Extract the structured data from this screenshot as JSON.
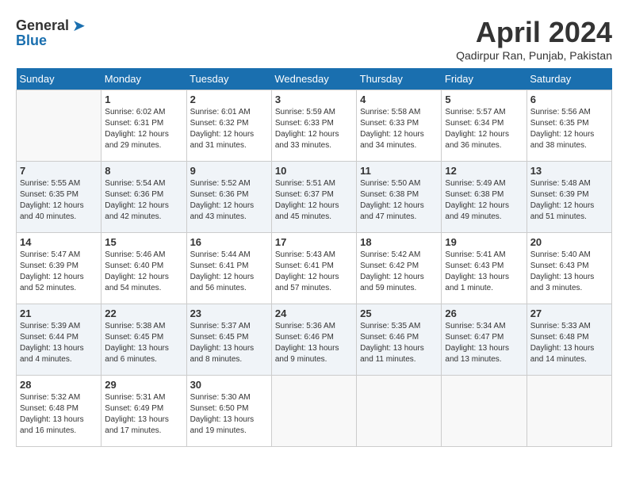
{
  "header": {
    "logo_general": "General",
    "logo_blue": "Blue",
    "month_title": "April 2024",
    "location": "Qadirpur Ran, Punjab, Pakistan"
  },
  "columns": [
    "Sunday",
    "Monday",
    "Tuesday",
    "Wednesday",
    "Thursday",
    "Friday",
    "Saturday"
  ],
  "weeks": [
    [
      {
        "day": "",
        "sunrise": "",
        "sunset": "",
        "daylight": ""
      },
      {
        "day": "1",
        "sunrise": "Sunrise: 6:02 AM",
        "sunset": "Sunset: 6:31 PM",
        "daylight": "Daylight: 12 hours and 29 minutes."
      },
      {
        "day": "2",
        "sunrise": "Sunrise: 6:01 AM",
        "sunset": "Sunset: 6:32 PM",
        "daylight": "Daylight: 12 hours and 31 minutes."
      },
      {
        "day": "3",
        "sunrise": "Sunrise: 5:59 AM",
        "sunset": "Sunset: 6:33 PM",
        "daylight": "Daylight: 12 hours and 33 minutes."
      },
      {
        "day": "4",
        "sunrise": "Sunrise: 5:58 AM",
        "sunset": "Sunset: 6:33 PM",
        "daylight": "Daylight: 12 hours and 34 minutes."
      },
      {
        "day": "5",
        "sunrise": "Sunrise: 5:57 AM",
        "sunset": "Sunset: 6:34 PM",
        "daylight": "Daylight: 12 hours and 36 minutes."
      },
      {
        "day": "6",
        "sunrise": "Sunrise: 5:56 AM",
        "sunset": "Sunset: 6:35 PM",
        "daylight": "Daylight: 12 hours and 38 minutes."
      }
    ],
    [
      {
        "day": "7",
        "sunrise": "Sunrise: 5:55 AM",
        "sunset": "Sunset: 6:35 PM",
        "daylight": "Daylight: 12 hours and 40 minutes."
      },
      {
        "day": "8",
        "sunrise": "Sunrise: 5:54 AM",
        "sunset": "Sunset: 6:36 PM",
        "daylight": "Daylight: 12 hours and 42 minutes."
      },
      {
        "day": "9",
        "sunrise": "Sunrise: 5:52 AM",
        "sunset": "Sunset: 6:36 PM",
        "daylight": "Daylight: 12 hours and 43 minutes."
      },
      {
        "day": "10",
        "sunrise": "Sunrise: 5:51 AM",
        "sunset": "Sunset: 6:37 PM",
        "daylight": "Daylight: 12 hours and 45 minutes."
      },
      {
        "day": "11",
        "sunrise": "Sunrise: 5:50 AM",
        "sunset": "Sunset: 6:38 PM",
        "daylight": "Daylight: 12 hours and 47 minutes."
      },
      {
        "day": "12",
        "sunrise": "Sunrise: 5:49 AM",
        "sunset": "Sunset: 6:38 PM",
        "daylight": "Daylight: 12 hours and 49 minutes."
      },
      {
        "day": "13",
        "sunrise": "Sunrise: 5:48 AM",
        "sunset": "Sunset: 6:39 PM",
        "daylight": "Daylight: 12 hours and 51 minutes."
      }
    ],
    [
      {
        "day": "14",
        "sunrise": "Sunrise: 5:47 AM",
        "sunset": "Sunset: 6:39 PM",
        "daylight": "Daylight: 12 hours and 52 minutes."
      },
      {
        "day": "15",
        "sunrise": "Sunrise: 5:46 AM",
        "sunset": "Sunset: 6:40 PM",
        "daylight": "Daylight: 12 hours and 54 minutes."
      },
      {
        "day": "16",
        "sunrise": "Sunrise: 5:44 AM",
        "sunset": "Sunset: 6:41 PM",
        "daylight": "Daylight: 12 hours and 56 minutes."
      },
      {
        "day": "17",
        "sunrise": "Sunrise: 5:43 AM",
        "sunset": "Sunset: 6:41 PM",
        "daylight": "Daylight: 12 hours and 57 minutes."
      },
      {
        "day": "18",
        "sunrise": "Sunrise: 5:42 AM",
        "sunset": "Sunset: 6:42 PM",
        "daylight": "Daylight: 12 hours and 59 minutes."
      },
      {
        "day": "19",
        "sunrise": "Sunrise: 5:41 AM",
        "sunset": "Sunset: 6:43 PM",
        "daylight": "Daylight: 13 hours and 1 minute."
      },
      {
        "day": "20",
        "sunrise": "Sunrise: 5:40 AM",
        "sunset": "Sunset: 6:43 PM",
        "daylight": "Daylight: 13 hours and 3 minutes."
      }
    ],
    [
      {
        "day": "21",
        "sunrise": "Sunrise: 5:39 AM",
        "sunset": "Sunset: 6:44 PM",
        "daylight": "Daylight: 13 hours and 4 minutes."
      },
      {
        "day": "22",
        "sunrise": "Sunrise: 5:38 AM",
        "sunset": "Sunset: 6:45 PM",
        "daylight": "Daylight: 13 hours and 6 minutes."
      },
      {
        "day": "23",
        "sunrise": "Sunrise: 5:37 AM",
        "sunset": "Sunset: 6:45 PM",
        "daylight": "Daylight: 13 hours and 8 minutes."
      },
      {
        "day": "24",
        "sunrise": "Sunrise: 5:36 AM",
        "sunset": "Sunset: 6:46 PM",
        "daylight": "Daylight: 13 hours and 9 minutes."
      },
      {
        "day": "25",
        "sunrise": "Sunrise: 5:35 AM",
        "sunset": "Sunset: 6:46 PM",
        "daylight": "Daylight: 13 hours and 11 minutes."
      },
      {
        "day": "26",
        "sunrise": "Sunrise: 5:34 AM",
        "sunset": "Sunset: 6:47 PM",
        "daylight": "Daylight: 13 hours and 13 minutes."
      },
      {
        "day": "27",
        "sunrise": "Sunrise: 5:33 AM",
        "sunset": "Sunset: 6:48 PM",
        "daylight": "Daylight: 13 hours and 14 minutes."
      }
    ],
    [
      {
        "day": "28",
        "sunrise": "Sunrise: 5:32 AM",
        "sunset": "Sunset: 6:48 PM",
        "daylight": "Daylight: 13 hours and 16 minutes."
      },
      {
        "day": "29",
        "sunrise": "Sunrise: 5:31 AM",
        "sunset": "Sunset: 6:49 PM",
        "daylight": "Daylight: 13 hours and 17 minutes."
      },
      {
        "day": "30",
        "sunrise": "Sunrise: 5:30 AM",
        "sunset": "Sunset: 6:50 PM",
        "daylight": "Daylight: 13 hours and 19 minutes."
      },
      {
        "day": "",
        "sunrise": "",
        "sunset": "",
        "daylight": ""
      },
      {
        "day": "",
        "sunrise": "",
        "sunset": "",
        "daylight": ""
      },
      {
        "day": "",
        "sunrise": "",
        "sunset": "",
        "daylight": ""
      },
      {
        "day": "",
        "sunrise": "",
        "sunset": "",
        "daylight": ""
      }
    ]
  ]
}
